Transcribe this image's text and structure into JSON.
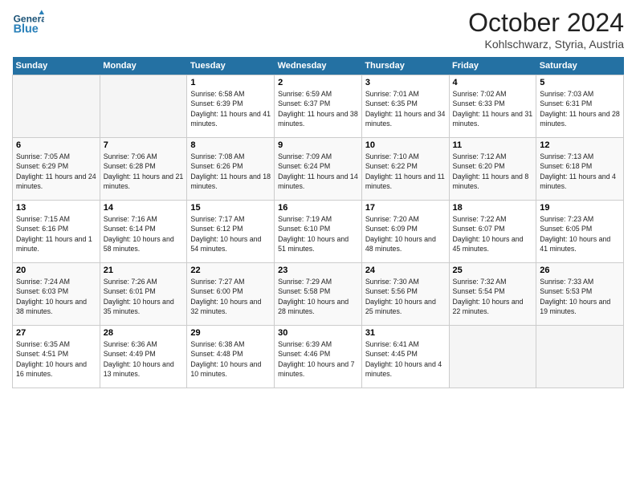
{
  "header": {
    "logo_general": "General",
    "logo_blue": "Blue",
    "title": "October 2024",
    "location": "Kohlschwarz, Styria, Austria"
  },
  "days_of_week": [
    "Sunday",
    "Monday",
    "Tuesday",
    "Wednesday",
    "Thursday",
    "Friday",
    "Saturday"
  ],
  "weeks": [
    [
      {
        "day": "",
        "sunrise": "",
        "sunset": "",
        "daylight": ""
      },
      {
        "day": "",
        "sunrise": "",
        "sunset": "",
        "daylight": ""
      },
      {
        "day": "1",
        "sunrise": "Sunrise: 6:58 AM",
        "sunset": "Sunset: 6:39 PM",
        "daylight": "Daylight: 11 hours and 41 minutes."
      },
      {
        "day": "2",
        "sunrise": "Sunrise: 6:59 AM",
        "sunset": "Sunset: 6:37 PM",
        "daylight": "Daylight: 11 hours and 38 minutes."
      },
      {
        "day": "3",
        "sunrise": "Sunrise: 7:01 AM",
        "sunset": "Sunset: 6:35 PM",
        "daylight": "Daylight: 11 hours and 34 minutes."
      },
      {
        "day": "4",
        "sunrise": "Sunrise: 7:02 AM",
        "sunset": "Sunset: 6:33 PM",
        "daylight": "Daylight: 11 hours and 31 minutes."
      },
      {
        "day": "5",
        "sunrise": "Sunrise: 7:03 AM",
        "sunset": "Sunset: 6:31 PM",
        "daylight": "Daylight: 11 hours and 28 minutes."
      }
    ],
    [
      {
        "day": "6",
        "sunrise": "Sunrise: 7:05 AM",
        "sunset": "Sunset: 6:29 PM",
        "daylight": "Daylight: 11 hours and 24 minutes."
      },
      {
        "day": "7",
        "sunrise": "Sunrise: 7:06 AM",
        "sunset": "Sunset: 6:28 PM",
        "daylight": "Daylight: 11 hours and 21 minutes."
      },
      {
        "day": "8",
        "sunrise": "Sunrise: 7:08 AM",
        "sunset": "Sunset: 6:26 PM",
        "daylight": "Daylight: 11 hours and 18 minutes."
      },
      {
        "day": "9",
        "sunrise": "Sunrise: 7:09 AM",
        "sunset": "Sunset: 6:24 PM",
        "daylight": "Daylight: 11 hours and 14 minutes."
      },
      {
        "day": "10",
        "sunrise": "Sunrise: 7:10 AM",
        "sunset": "Sunset: 6:22 PM",
        "daylight": "Daylight: 11 hours and 11 minutes."
      },
      {
        "day": "11",
        "sunrise": "Sunrise: 7:12 AM",
        "sunset": "Sunset: 6:20 PM",
        "daylight": "Daylight: 11 hours and 8 minutes."
      },
      {
        "day": "12",
        "sunrise": "Sunrise: 7:13 AM",
        "sunset": "Sunset: 6:18 PM",
        "daylight": "Daylight: 11 hours and 4 minutes."
      }
    ],
    [
      {
        "day": "13",
        "sunrise": "Sunrise: 7:15 AM",
        "sunset": "Sunset: 6:16 PM",
        "daylight": "Daylight: 11 hours and 1 minute."
      },
      {
        "day": "14",
        "sunrise": "Sunrise: 7:16 AM",
        "sunset": "Sunset: 6:14 PM",
        "daylight": "Daylight: 10 hours and 58 minutes."
      },
      {
        "day": "15",
        "sunrise": "Sunrise: 7:17 AM",
        "sunset": "Sunset: 6:12 PM",
        "daylight": "Daylight: 10 hours and 54 minutes."
      },
      {
        "day": "16",
        "sunrise": "Sunrise: 7:19 AM",
        "sunset": "Sunset: 6:10 PM",
        "daylight": "Daylight: 10 hours and 51 minutes."
      },
      {
        "day": "17",
        "sunrise": "Sunrise: 7:20 AM",
        "sunset": "Sunset: 6:09 PM",
        "daylight": "Daylight: 10 hours and 48 minutes."
      },
      {
        "day": "18",
        "sunrise": "Sunrise: 7:22 AM",
        "sunset": "Sunset: 6:07 PM",
        "daylight": "Daylight: 10 hours and 45 minutes."
      },
      {
        "day": "19",
        "sunrise": "Sunrise: 7:23 AM",
        "sunset": "Sunset: 6:05 PM",
        "daylight": "Daylight: 10 hours and 41 minutes."
      }
    ],
    [
      {
        "day": "20",
        "sunrise": "Sunrise: 7:24 AM",
        "sunset": "Sunset: 6:03 PM",
        "daylight": "Daylight: 10 hours and 38 minutes."
      },
      {
        "day": "21",
        "sunrise": "Sunrise: 7:26 AM",
        "sunset": "Sunset: 6:01 PM",
        "daylight": "Daylight: 10 hours and 35 minutes."
      },
      {
        "day": "22",
        "sunrise": "Sunrise: 7:27 AM",
        "sunset": "Sunset: 6:00 PM",
        "daylight": "Daylight: 10 hours and 32 minutes."
      },
      {
        "day": "23",
        "sunrise": "Sunrise: 7:29 AM",
        "sunset": "Sunset: 5:58 PM",
        "daylight": "Daylight: 10 hours and 28 minutes."
      },
      {
        "day": "24",
        "sunrise": "Sunrise: 7:30 AM",
        "sunset": "Sunset: 5:56 PM",
        "daylight": "Daylight: 10 hours and 25 minutes."
      },
      {
        "day": "25",
        "sunrise": "Sunrise: 7:32 AM",
        "sunset": "Sunset: 5:54 PM",
        "daylight": "Daylight: 10 hours and 22 minutes."
      },
      {
        "day": "26",
        "sunrise": "Sunrise: 7:33 AM",
        "sunset": "Sunset: 5:53 PM",
        "daylight": "Daylight: 10 hours and 19 minutes."
      }
    ],
    [
      {
        "day": "27",
        "sunrise": "Sunrise: 6:35 AM",
        "sunset": "Sunset: 4:51 PM",
        "daylight": "Daylight: 10 hours and 16 minutes."
      },
      {
        "day": "28",
        "sunrise": "Sunrise: 6:36 AM",
        "sunset": "Sunset: 4:49 PM",
        "daylight": "Daylight: 10 hours and 13 minutes."
      },
      {
        "day": "29",
        "sunrise": "Sunrise: 6:38 AM",
        "sunset": "Sunset: 4:48 PM",
        "daylight": "Daylight: 10 hours and 10 minutes."
      },
      {
        "day": "30",
        "sunrise": "Sunrise: 6:39 AM",
        "sunset": "Sunset: 4:46 PM",
        "daylight": "Daylight: 10 hours and 7 minutes."
      },
      {
        "day": "31",
        "sunrise": "Sunrise: 6:41 AM",
        "sunset": "Sunset: 4:45 PM",
        "daylight": "Daylight: 10 hours and 4 minutes."
      },
      {
        "day": "",
        "sunrise": "",
        "sunset": "",
        "daylight": ""
      },
      {
        "day": "",
        "sunrise": "",
        "sunset": "",
        "daylight": ""
      }
    ]
  ]
}
